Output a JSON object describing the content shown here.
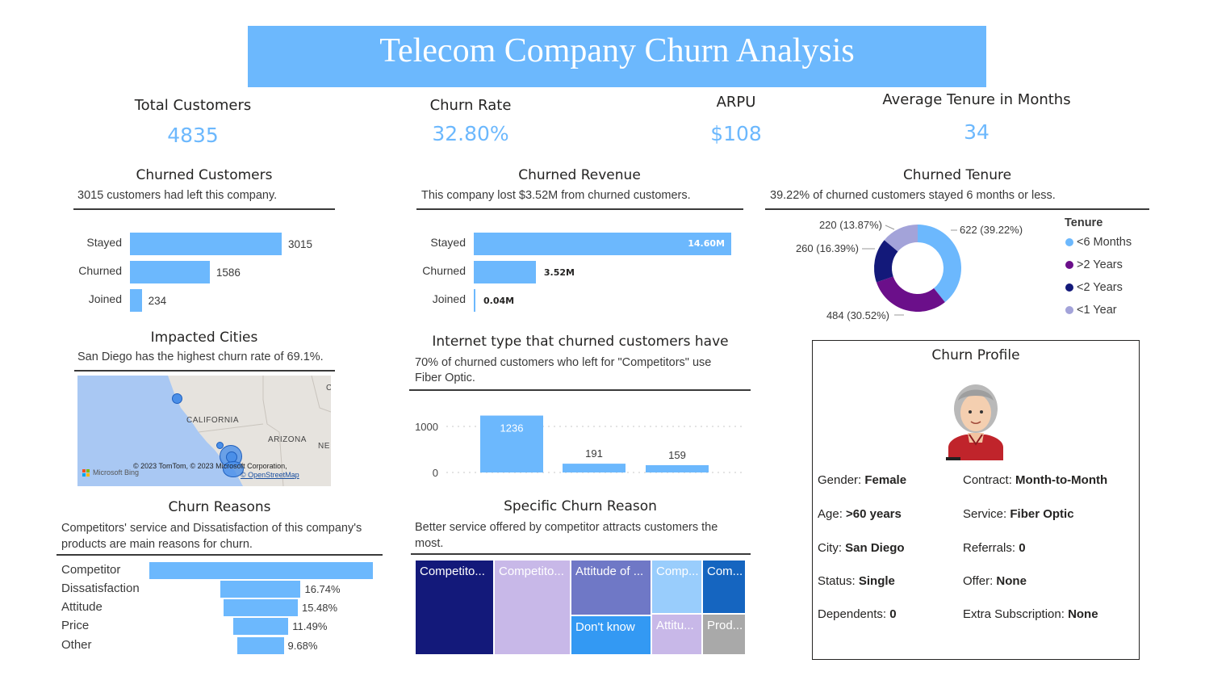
{
  "title": "Telecom Company Churn Analysis",
  "kpis": {
    "total_customers": {
      "label": "Total Customers",
      "value": "4835"
    },
    "churn_rate": {
      "label": "Churn Rate",
      "value": "32.80%"
    },
    "arpu": {
      "label": "ARPU",
      "value": "$108"
    },
    "avg_tenure": {
      "label": "Average Tenure in Months",
      "value": "34"
    }
  },
  "churned_customers": {
    "title": "Churned Customers",
    "subtitle": "3015 customers had left this company."
  },
  "churned_revenue": {
    "title": "Churned Revenue",
    "subtitle": "This company lost $3.52M from churned customers."
  },
  "churned_tenure": {
    "title": "Churned Tenure",
    "subtitle": "39.22% of churned customers stayed 6 months or less.",
    "legend_title": "Tenure"
  },
  "impacted_cities": {
    "title": "Impacted Cities",
    "subtitle": "San Diego has the highest churn rate of 69.1%.",
    "map_labels": {
      "state": "CALIFORNIA",
      "state2": "ARIZONA",
      "edge": "NE",
      "edge2": "C"
    },
    "credits": {
      "bing": "Microsoft Bing",
      "copyright": "© 2023 TomTom, © 2023 Microsoft Corporation,",
      "osm": "© OpenStreetMap"
    }
  },
  "internet_type": {
    "title": "Internet type that churned customers have",
    "subtitle": "70% of churned customers who left for \"Competitors\" use Fiber Optic."
  },
  "churn_reasons": {
    "title": "Churn Reasons",
    "subtitle": "Competitors' service and Dissatisfaction of this company's products are main reasons for churn."
  },
  "specific_reason": {
    "title": "Specific Churn Reason",
    "subtitle": "Better service offered by competitor attracts customers the most."
  },
  "profile": {
    "title": "Churn Profile",
    "left": [
      {
        "k": "Gender:",
        "v": "Female"
      },
      {
        "k": "Age:",
        "v": ">60 years"
      },
      {
        "k": "City:",
        "v": "San Diego"
      },
      {
        "k": "Status:",
        "v": "Single"
      },
      {
        "k": "Dependents:",
        "v": "0"
      }
    ],
    "right": [
      {
        "k": "Contract:",
        "v": "Month-to-Month"
      },
      {
        "k": "Service:",
        "v": "Fiber Optic"
      },
      {
        "k": "Referrals:",
        "v": "0"
      },
      {
        "k": "Offer:",
        "v": "None"
      },
      {
        "k": "Extra Subscription:",
        "v": "None"
      }
    ]
  },
  "colors": {
    "accent": "#6cb8fd",
    "navy": "#13197a",
    "purple": "#6b0f8a",
    "lavender": "#a3a3d9",
    "treemap_lilac": "#c8b8e8",
    "treemap_slate": "#6f78c6",
    "treemap_blue": "#1565c0",
    "treemap_light": "#99cdfc",
    "treemap_grey": "#a9a9a9"
  },
  "chart_data": [
    {
      "id": "churned_customers",
      "type": "bar",
      "orientation": "horizontal",
      "categories": [
        "Stayed",
        "Churned",
        "Joined"
      ],
      "values": [
        3015,
        1586,
        234
      ],
      "value_labels": [
        "3015",
        "1586",
        "234"
      ]
    },
    {
      "id": "churned_revenue",
      "type": "bar",
      "orientation": "horizontal",
      "categories": [
        "Stayed",
        "Churned",
        "Joined"
      ],
      "values": [
        14.6,
        3.52,
        0.04
      ],
      "value_labels": [
        "14.60M",
        "3.52M",
        "0.04M"
      ]
    },
    {
      "id": "churned_tenure",
      "type": "pie",
      "donut": true,
      "categories": [
        "<6 Months",
        ">2 Years",
        "<2 Years",
        "<1 Year"
      ],
      "values": [
        622,
        484,
        260,
        220
      ],
      "value_labels": [
        "622 (39.22%)",
        "484 (30.52%)",
        "260 (16.39%)",
        "220 (13.87%)"
      ],
      "colors": [
        "#6cb8fd",
        "#6b0f8a",
        "#13197a",
        "#a3a3d9"
      ],
      "legend_title": "Tenure",
      "legend": "right"
    },
    {
      "id": "internet_type",
      "type": "bar",
      "orientation": "vertical",
      "values": [
        1236,
        191,
        159
      ],
      "value_labels": [
        "1236",
        "191",
        "159"
      ],
      "yticks": [
        "1000",
        "0"
      ],
      "ylim": [
        0,
        1300
      ],
      "grid": true
    },
    {
      "id": "churn_reasons",
      "type": "bar",
      "orientation": "horizontal",
      "categories": [
        "Competitor",
        "Dissatisfaction",
        "Attitude",
        "Price",
        "Other"
      ],
      "values": [
        46.61,
        16.74,
        15.48,
        11.49,
        9.68
      ],
      "value_labels": [
        "",
        "16.74%",
        "15.48%",
        "11.49%",
        "9.68%"
      ]
    },
    {
      "id": "specific_reason",
      "type": "treemap",
      "labels": [
        "Competito...",
        "Competito...",
        "Attitude of ...",
        "Don't know",
        "Comp...",
        "Attitu...",
        "Com...",
        "Prod..."
      ]
    }
  ]
}
